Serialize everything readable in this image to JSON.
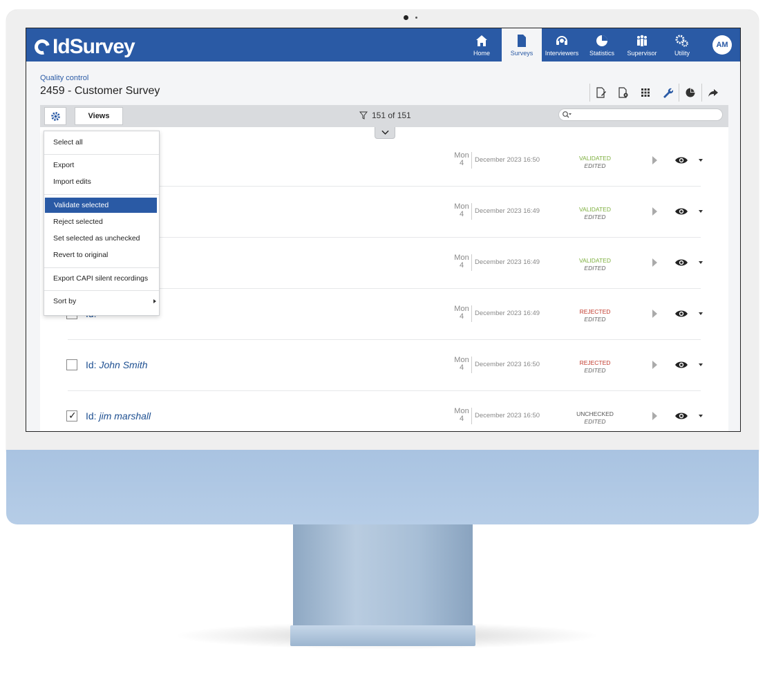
{
  "app": {
    "logo_text": "IdSurvey",
    "avatar_initials": "AM",
    "nav": [
      {
        "label": "Home",
        "icon": "home-icon"
      },
      {
        "label": "Surveys",
        "icon": "document-icon",
        "active": true
      },
      {
        "label": "Interviewers",
        "icon": "headset-icon"
      },
      {
        "label": "Statistics",
        "icon": "pie-chart-icon"
      },
      {
        "label": "Supervisor",
        "icon": "people-icon"
      },
      {
        "label": "Utility",
        "icon": "gears-icon"
      }
    ]
  },
  "page": {
    "breadcrumb": "Quality control",
    "title": "2459 - Customer Survey"
  },
  "toolbar": {
    "icons": [
      "edit-document-icon",
      "document-settings-icon",
      "grid-icon",
      "wrench-icon",
      "pie-chart-icon",
      "share-icon"
    ]
  },
  "filterbar": {
    "views_label": "Views",
    "count": "151 of 151",
    "search_placeholder": ""
  },
  "menu": {
    "items": [
      {
        "label": "Select all"
      },
      {
        "label": "Export"
      },
      {
        "label": "Import edits"
      },
      {
        "label": "Validate selected",
        "highlight": true
      },
      {
        "label": "Reject selected"
      },
      {
        "label": "Set selected as unchecked"
      },
      {
        "label": "Revert to original"
      },
      {
        "label": "Export CAPI silent recordings"
      },
      {
        "label": "Sort by"
      }
    ]
  },
  "rows": [
    {
      "id_prefix": "Id:",
      "id": "",
      "checked": false,
      "day": "Mon",
      "day_num": "4",
      "date": "December 2023 16:50",
      "status": "VALIDATED",
      "sub": "EDITED",
      "status_color": "#7cae3c"
    },
    {
      "id_prefix": "Id:",
      "id": "",
      "checked": false,
      "day": "Mon",
      "day_num": "4",
      "date": "December 2023 16:49",
      "status": "VALIDATED",
      "sub": "EDITED",
      "status_color": "#7cae3c"
    },
    {
      "id_prefix": "Id:",
      "id": "",
      "checked": false,
      "day": "Mon",
      "day_num": "4",
      "date": "December 2023 16:49",
      "status": "VALIDATED",
      "sub": "EDITED",
      "status_color": "#7cae3c"
    },
    {
      "id_prefix": "Id:",
      "id": "",
      "checked": false,
      "day": "Mon",
      "day_num": "4",
      "date": "December 2023 16:49",
      "status": "REJECTED",
      "sub": "EDITED",
      "status_color": "#c0392b"
    },
    {
      "id_prefix": "Id:",
      "id": "John Smith",
      "checked": false,
      "day": "Mon",
      "day_num": "4",
      "date": "December 2023 16:50",
      "status": "REJECTED",
      "sub": "EDITED",
      "status_color": "#c0392b"
    },
    {
      "id_prefix": "Id:",
      "id": "jim marshall",
      "checked": true,
      "day": "Mon",
      "day_num": "4",
      "date": "December 2023 16:50",
      "status": "UNCHECKED",
      "sub": "EDITED",
      "status_color": "#555555"
    }
  ],
  "colors": {
    "brand": "#2a5aa5",
    "chin": "#b0c8e4"
  }
}
